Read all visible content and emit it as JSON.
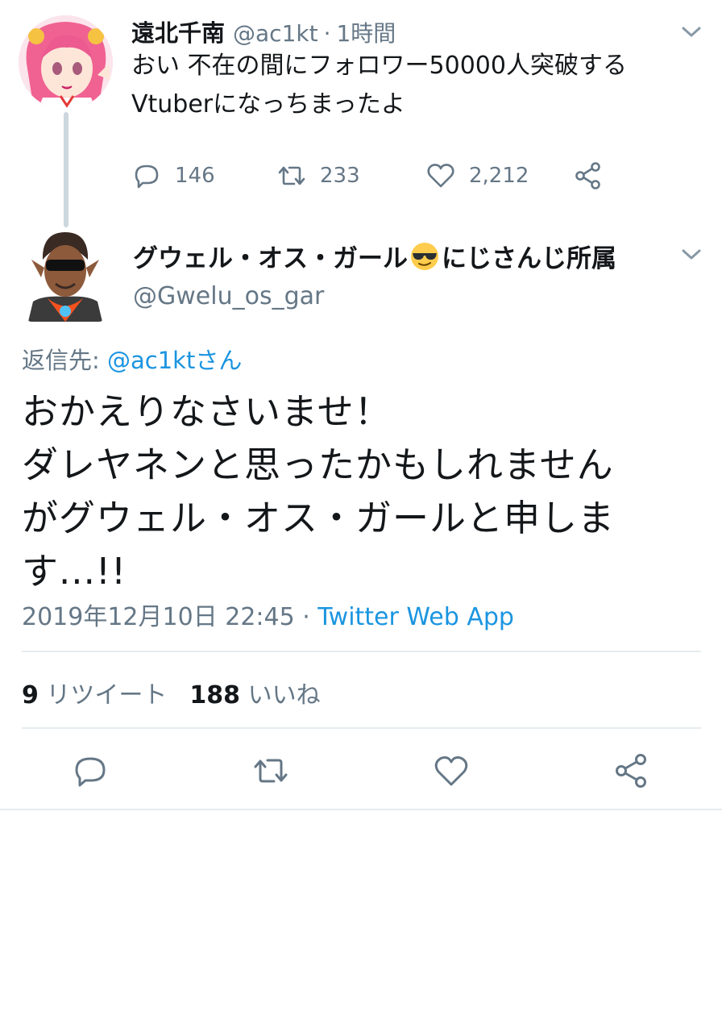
{
  "parent_tweet": {
    "display_name": "遠北千南",
    "handle": "@ac1kt",
    "separator": "·",
    "time_ago": "1時間",
    "text_line1": "おい 不在の間にフォロワー50000人突破する",
    "text_line2": "Vtuberになっちまったよ",
    "reply_count": "146",
    "retweet_count": "233",
    "like_count": "2,212"
  },
  "main_tweet": {
    "display_name_before_emoji": "グウェル・オス・ガール",
    "display_name_after_emoji": "にじさんじ所属",
    "handle": "@Gwelu_os_gar",
    "reply_prefix": "返信先: ",
    "reply_mention": "@ac1ktさん",
    "text_line1": "おかえりなさいませ！",
    "text_line2": "ダレヤネンと思ったかもしれません",
    "text_line3": "がグウェル・オス・ガールと申しま",
    "text_line4": "す...!!",
    "timestamp": "2019年12月10日 22:45",
    "meta_separator": " · ",
    "source": "Twitter Web App",
    "retweets_num": "9",
    "retweets_label": " リツイート",
    "likes_num": "188",
    "likes_label": " いいね"
  },
  "icons": {
    "reply": "reply-bubble-icon",
    "retweet": "retweet-arrows-icon",
    "like": "heart-icon",
    "share": "share-icon",
    "menu": "chevron-down-icon",
    "emoji": "sunglasses-emoji"
  },
  "colors": {
    "text_primary": "#14171a",
    "text_secondary": "#657786",
    "link": "#1b95e0",
    "divider": "#e6ecf0",
    "thread_line": "#ccd6dd"
  }
}
